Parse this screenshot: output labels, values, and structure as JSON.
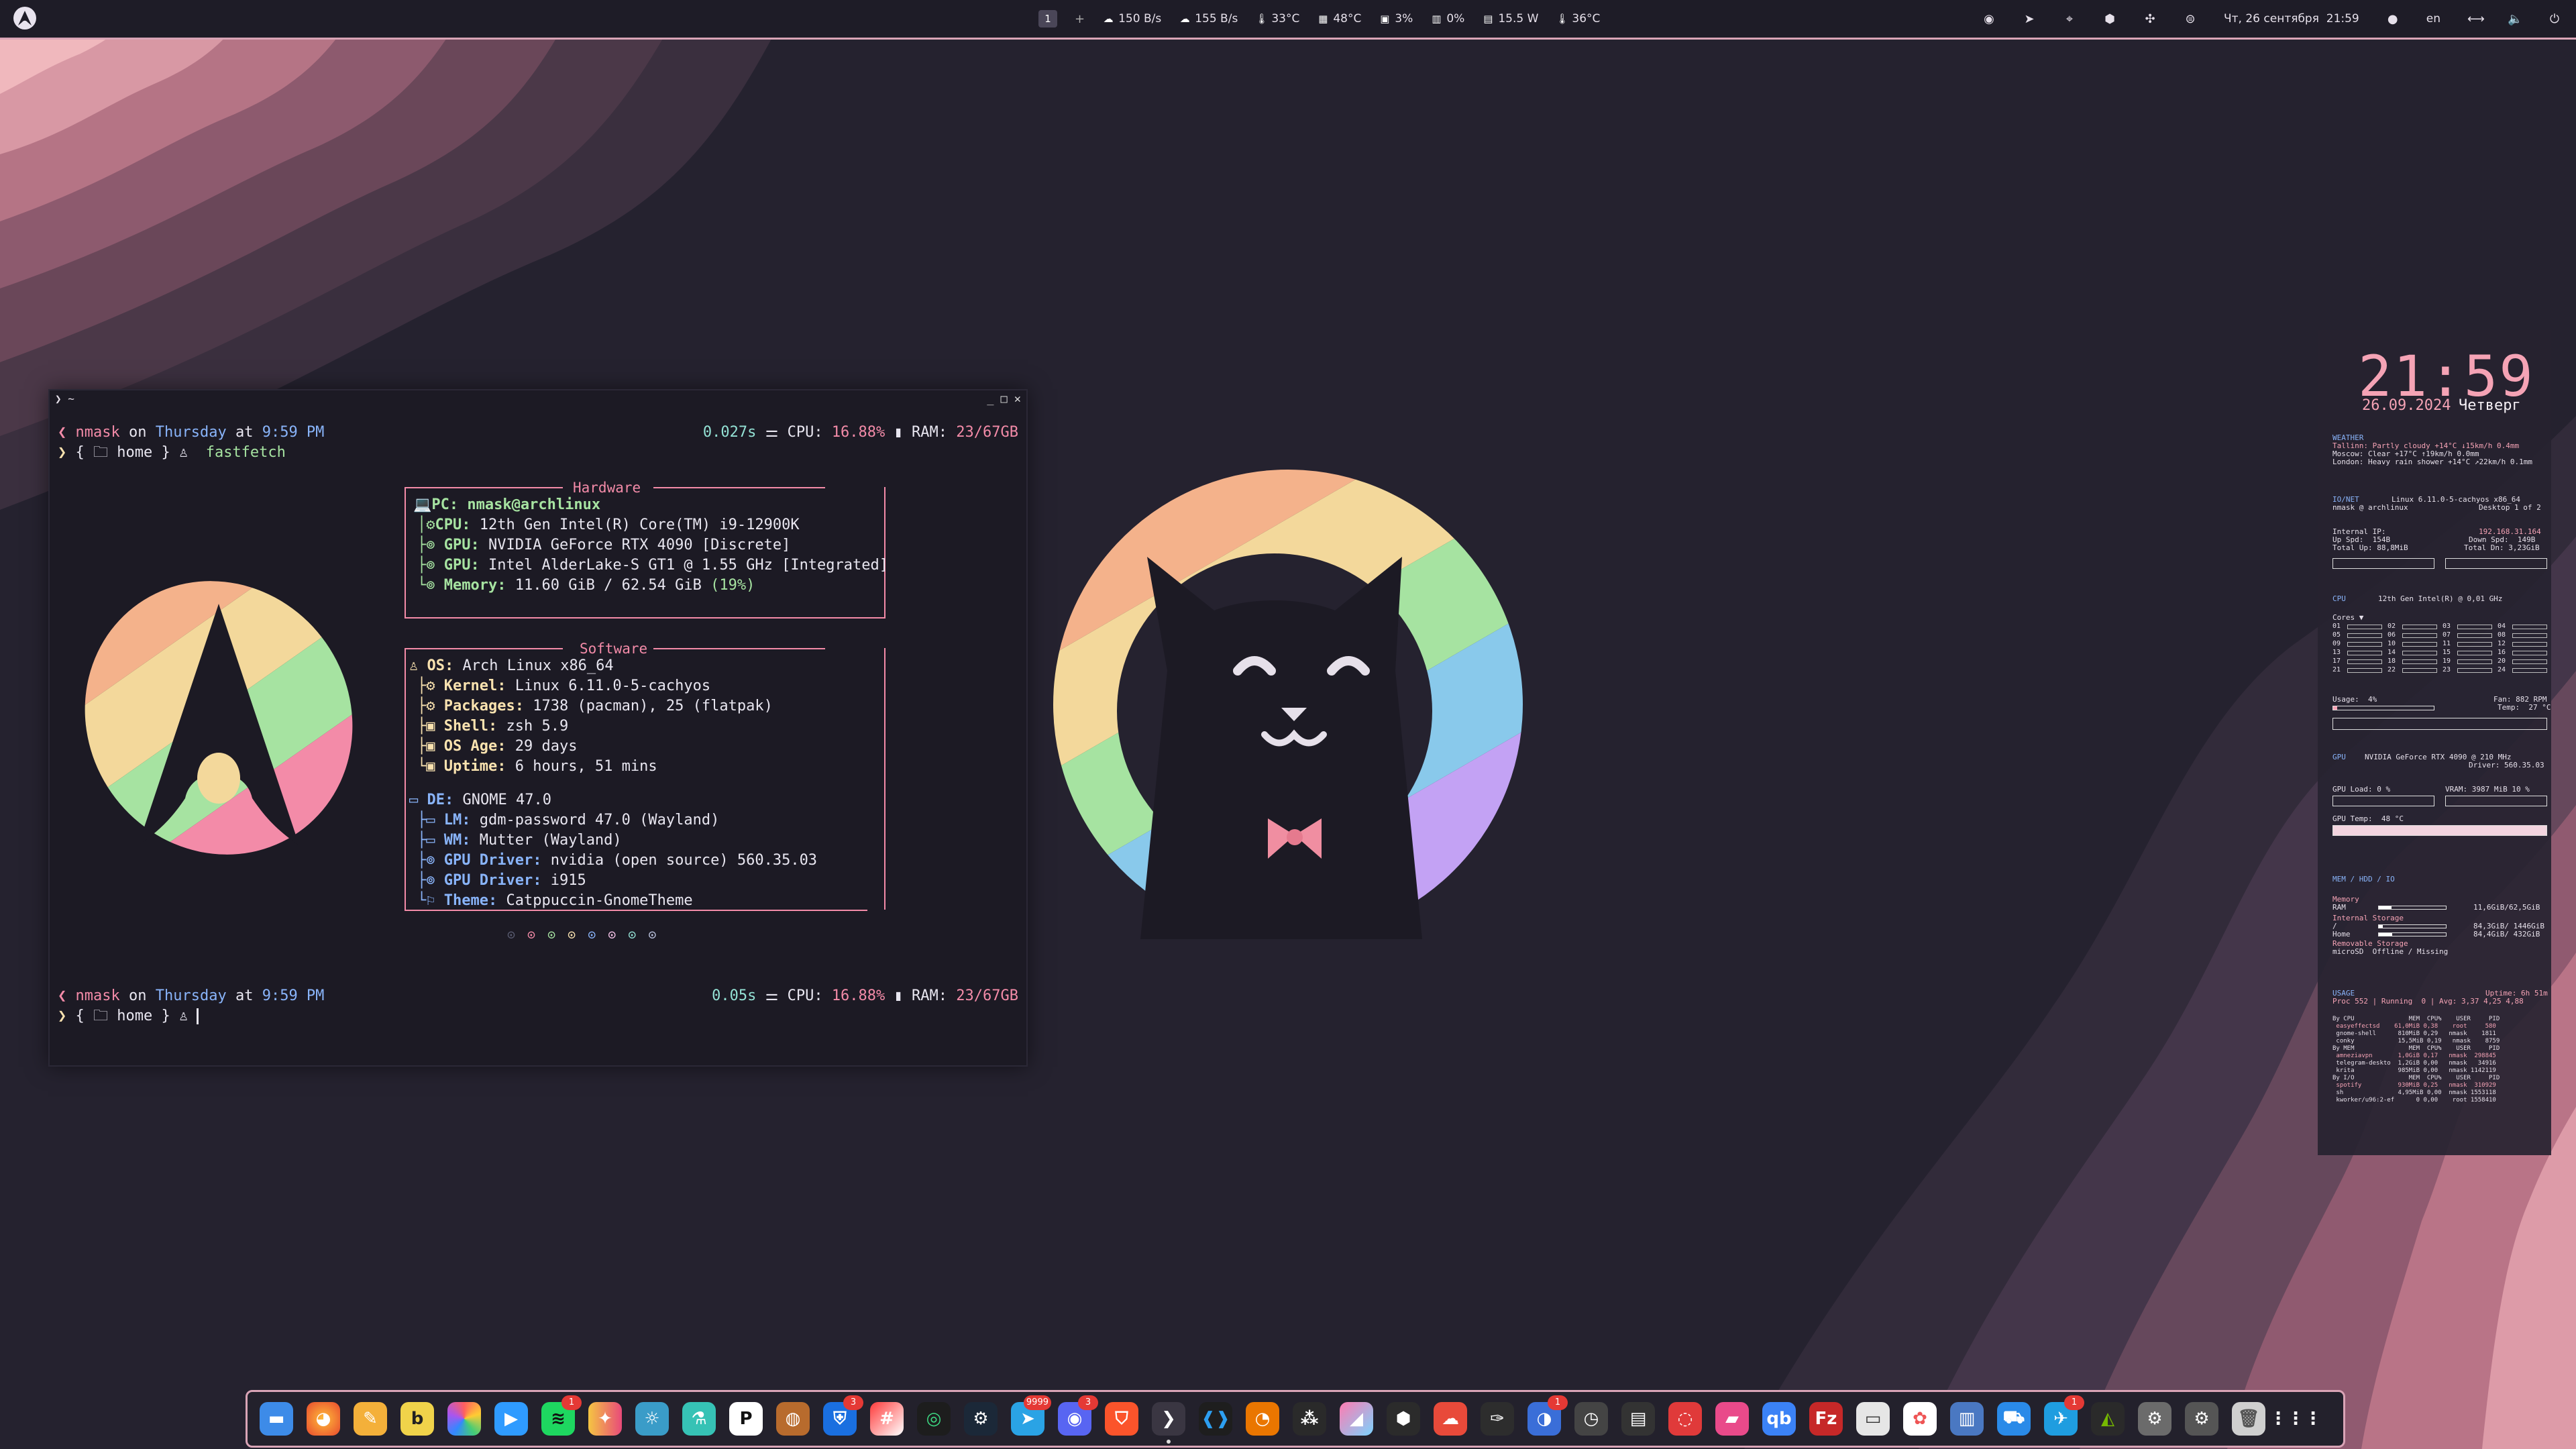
{
  "topbar": {
    "workspace": "1",
    "workspace_add": "+",
    "net_up": "150 B/s",
    "net_down": "155 B/s",
    "temp1": "33°C",
    "cpu_temp": "48°C",
    "cpu_load": "3%",
    "gpu_load": "0%",
    "power": "15.5 W",
    "gpu_temp": "36°C",
    "datetime": "Чт, 26 сентября  21:59",
    "language": "en"
  },
  "terminal": {
    "title": "❯ ~",
    "prompt1": {
      "user": "nmask",
      "on": "on",
      "day": "Thursday",
      "at": "at",
      "time": "9:59 PM",
      "duration": "0.027s",
      "cpu_label": "CPU:",
      "cpu": "16.88%",
      "ram_label": "RAM:",
      "ram": "23/67GB"
    },
    "dir_line1": "{ 🗀 home } ♙",
    "command": "fastfetch",
    "hardware": {
      "label": "Hardware",
      "pc_key": "PC:",
      "pc": "nmask@archlinux",
      "cpu_key": "CPU:",
      "cpu": "12th Gen Intel(R) Core(TM) i9-12900K",
      "gpu1_key": "GPU:",
      "gpu1": "NVIDIA GeForce RTX 4090 [Discrete]",
      "gpu2_key": "GPU:",
      "gpu2": "Intel AlderLake-S GT1 @ 1.55 GHz [Integrated]",
      "mem_key": "Memory:",
      "mem": "11.60 GiB / 62.54 GiB",
      "mem_pct": "(19%)"
    },
    "software": {
      "label": "Software",
      "os_key": "OS:",
      "os": "Arch Linux x86_64",
      "kernel_key": "Kernel:",
      "kernel": "Linux 6.11.0-5-cachyos",
      "packages_key": "Packages:",
      "packages": "1738 (pacman), 25 (flatpak)",
      "shell_key": "Shell:",
      "shell": "zsh 5.9",
      "osage_key": "OS Age:",
      "osage": "29 days",
      "uptime_key": "Uptime:",
      "uptime": "6 hours, 51 mins"
    },
    "desktop": {
      "de_key": "DE:",
      "de": "GNOME 47.0",
      "lm_key": "LM:",
      "lm": "gdm-password 47.0 (Wayland)",
      "wm_key": "WM:",
      "wm": "Mutter (Wayland)",
      "drv1_key": "GPU Driver:",
      "drv1": "nvidia (open source) 560.35.03",
      "drv2_key": "GPU Driver:",
      "drv2": "i915",
      "theme_key": "Theme:",
      "theme": "Catppuccin-GnomeTheme"
    },
    "prompt2": {
      "user": "nmask",
      "on": "on",
      "day": "Thursday",
      "at": "at",
      "time": "9:59 PM",
      "duration": "0.05s",
      "cpu_label": "CPU:",
      "cpu": "16.88%",
      "ram_label": "RAM:",
      "ram": "23/67GB"
    },
    "dir_line2": "{ 🗀 home } ♙"
  },
  "conky": {
    "time": "21:59",
    "date": "26.09.2024",
    "weekday": "Четверг",
    "weather_title": "WEATHER",
    "weather1": "Tallinn: Partly cloudy +14°C ↓15km/h 0.4mm",
    "weather2": "Moscow: Clear +17°C ↑19km/h 0.0mm",
    "weather3": "London: Heavy rain shower +14°C ↗22km/h 0.1mm",
    "ionet_title": "IO/NET",
    "kernel": "Linux 6.11.0-5-cachyos x86_64",
    "user_host": "nmask @ archlinux",
    "desktop": "Desktop 1 of 2",
    "internal_ip_label": "Internal IP:",
    "internal_ip": "192.168.31.164",
    "up_spd": "Up Spd:  154B",
    "down_spd": "Down Spd:  149B",
    "total_up": "Total Up: 88,8MiB",
    "total_dn": "Total Dn: 3,23GiB",
    "cpu_title": "CPU",
    "cpu_name": "12th Gen Intel(R) @ 0,01 GHz",
    "cores_label": "Cores ▼",
    "usage_label": "Usage:  4%",
    "fan": "Fan: 882 RPM",
    "temp": "Temp:  27 °C",
    "gpu_title": "GPU",
    "gpu_name": "NVIDIA GeForce RTX 4090 @ 210 MHz",
    "driver": "Driver: 560.35.03",
    "gpu_load": "GPU Load: 0 %",
    "vram": "VRAM: 3987 MiB 10 %",
    "gpu_temp": "GPU Temp:  48 °C",
    "mem_title": "MEM / HDD / IO",
    "memory_label": "Memory",
    "ram_row": "RAM",
    "ram_val": "11,6GiB/62,5GiB",
    "internal_storage": "Internal Storage",
    "root_label": "/",
    "root_val": "84,3GiB/ 1446GiB",
    "home_label": "Home",
    "home_val": "84,4GiB/ 432GiB",
    "removable": "Removable Storage",
    "microsd": "microSD  Offline / Missing",
    "usage_title": "USAGE",
    "uptime": "Uptime: 6h 51m",
    "procs": "Proc 552 | Running  0 | Avg: 3,37 4,25 4,88",
    "proc_rows": [
      "By CPU               MEM  CPU%    USER     PID",
      " easyeffectsd    61,0MiB 0,38    root     580",
      " gnome-shell      810MiB 0,29   nmask    1811",
      " conky            15,5MiB 0,19   nmask    8759",
      "By MEM               MEM  CPU%    USER     PID",
      " amneziavpn       1,0GiB 0,17   nmask  298845",
      " telegram-deskto  1,2GiB 0,00   nmask   34916",
      " krita            985MiB 0,00   nmask 1142119",
      "By I/O               MEM  CPU%    USER     PID",
      " spotify          930MiB 0,25   nmask  310929",
      " sh               4,95MiB 0,00  nmask 1553118",
      " kworker/u96:2-ef      0 0,00    root 1558410"
    ]
  },
  "dock": {
    "badges": {
      "spotify": "1",
      "bitwarden": "3",
      "telegram": "9999",
      "discord": "3",
      "firefox2": "1",
      "settings_app": "1"
    }
  },
  "colors": {
    "accent": "#f5a3b5",
    "bg": "#25222f",
    "terminal_bg": "#1c1a24"
  }
}
